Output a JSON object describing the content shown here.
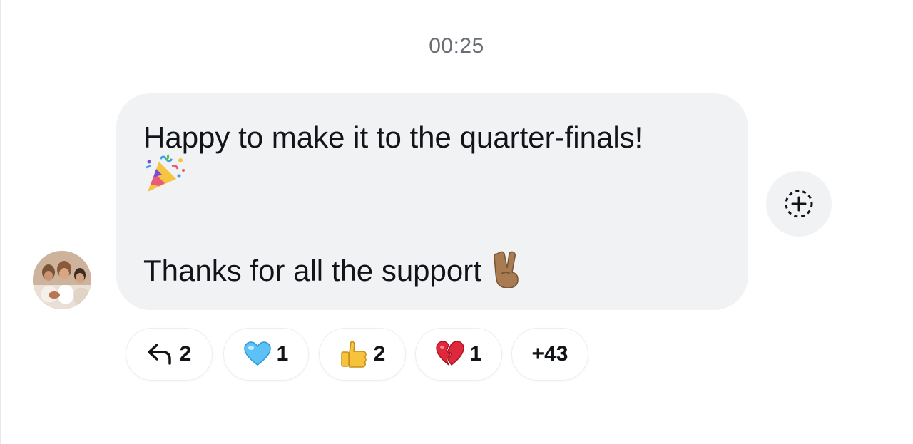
{
  "timestamp": "00:25",
  "message": {
    "line1": "Happy to make it to the quarter-finals!",
    "line2": "Thanks for all the support",
    "emoji_party": "party-popper-icon",
    "emoji_peace": "victory-hand-icon"
  },
  "reactions": [
    {
      "icon": "reply-icon",
      "count": "2"
    },
    {
      "icon": "blue-heart-icon",
      "count": "1"
    },
    {
      "icon": "thumbs-up-icon",
      "count": "2"
    },
    {
      "icon": "broken-heart-icon",
      "count": "1"
    },
    {
      "icon": null,
      "count": "+43"
    }
  ],
  "colors": {
    "bubble": "#f1f2f4",
    "timestamp": "#6b6f75",
    "text": "#111418"
  }
}
